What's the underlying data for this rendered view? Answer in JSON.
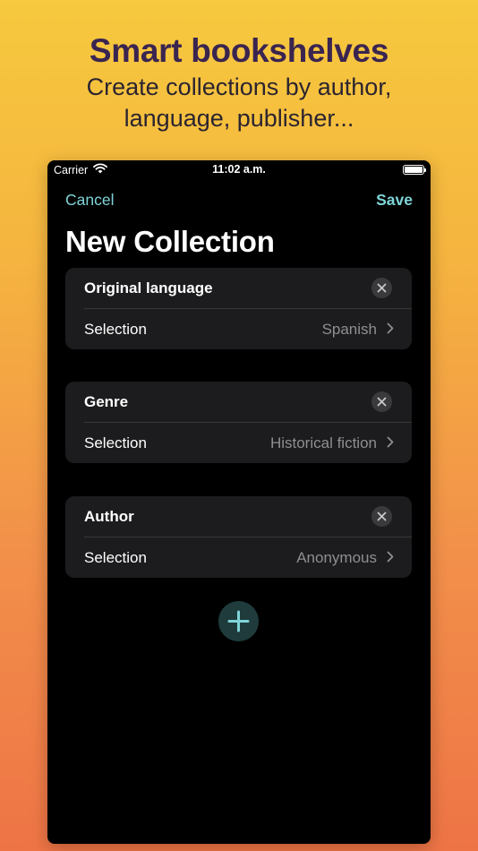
{
  "promo": {
    "title": "Smart bookshelves",
    "subtitle": "Create collections by author, language, publisher..."
  },
  "status_bar": {
    "carrier": "Carrier",
    "time": "11:02 a.m.",
    "icons": [
      "wifi-icon",
      "battery-icon"
    ]
  },
  "nav": {
    "cancel_label": "Cancel",
    "save_label": "Save"
  },
  "page_title": "New Collection",
  "filters": [
    {
      "title": "Original language",
      "row_label": "Selection",
      "value": "Spanish"
    },
    {
      "title": "Genre",
      "row_label": "Selection",
      "value": "Historical fiction"
    },
    {
      "title": "Author",
      "row_label": "Selection",
      "value": "Anonymous"
    }
  ],
  "icons": {
    "remove": "close-circle-icon",
    "disclosure": "chevron-right-icon",
    "add": "plus-icon"
  },
  "colors": {
    "accent": "#7fd4d8",
    "promo_title": "#3a2550",
    "background_top": "#f6c93e",
    "background_bottom": "#ee7446",
    "card": "#1c1c1e"
  }
}
